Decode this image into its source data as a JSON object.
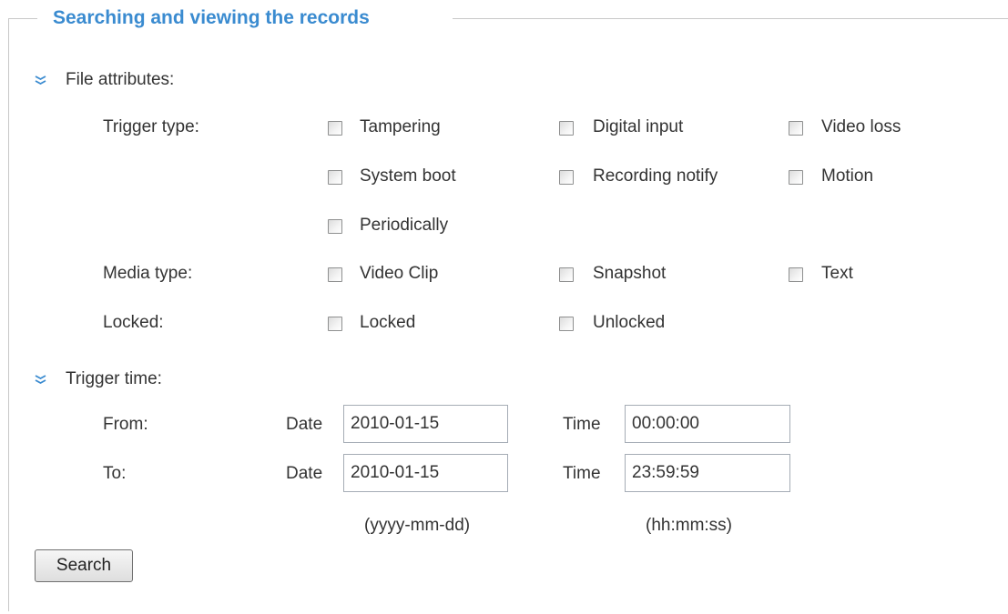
{
  "fieldset": {
    "legend": "Searching and viewing the records"
  },
  "file_attributes": {
    "heading": "File attributes:",
    "trigger_type": {
      "label": "Trigger type:",
      "options": [
        "Tampering",
        "Digital input",
        "Video loss",
        "System boot",
        "Recording notify",
        "Motion",
        "Periodically"
      ]
    },
    "media_type": {
      "label": "Media type:",
      "options": [
        "Video Clip",
        "Snapshot",
        "Text"
      ]
    },
    "locked": {
      "label": "Locked:",
      "options": [
        "Locked",
        "Unlocked"
      ]
    }
  },
  "trigger_time": {
    "heading": "Trigger time:",
    "from": {
      "label": "From:",
      "date_label": "Date",
      "date_value": "2010-01-15",
      "time_label": "Time",
      "time_value": "00:00:00"
    },
    "to": {
      "label": "To:",
      "date_label": "Date",
      "date_value": "2010-01-15",
      "time_label": "Time",
      "time_value": "23:59:59"
    },
    "date_hint": "(yyyy-mm-dd)",
    "time_hint": "(hh:mm:ss)"
  },
  "search_button": {
    "label": "Search"
  },
  "icons": {
    "section_arrow": "double-chevron-down-icon"
  },
  "colors": {
    "legend": "#3a8bd0",
    "arrow": "#3a8bd0",
    "text": "#333333",
    "border": "#c8c8c8"
  }
}
